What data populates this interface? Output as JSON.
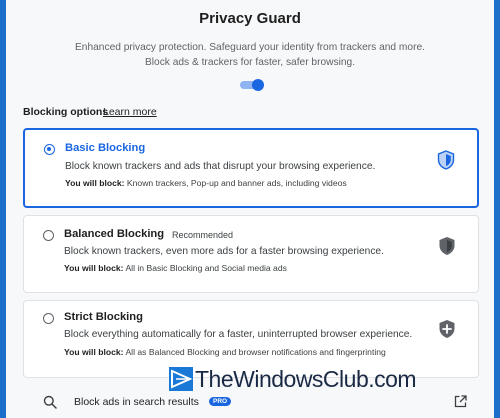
{
  "header": {
    "title": "Privacy Guard",
    "description": "Enhanced privacy protection. Safeguard your identity from trackers and more. Block ads & trackers for faster, safer browsing.",
    "toggle_on": true
  },
  "blocking": {
    "heading": "Blocking options",
    "learn_more": "Learn more",
    "block_prefix": "You will block:",
    "options": [
      {
        "title": "Basic Blocking",
        "tag": "",
        "selected": true,
        "description": "Block known trackers and ads that disrupt your browsing experience.",
        "blocks": "Known trackers, Pop-up and banner ads, including videos",
        "icon": "shield-icon"
      },
      {
        "title": "Balanced Blocking",
        "tag": "Recommended",
        "selected": false,
        "description": "Block known trackers, even more ads for a faster browsing experience.",
        "blocks": "All in Basic Blocking and Social media ads",
        "icon": "shield-icon"
      },
      {
        "title": "Strict Blocking",
        "tag": "",
        "selected": false,
        "description": "Block everything automatically for a faster, uninterrupted browser experience.",
        "blocks": "All as Balanced Blocking and browser notifications and fingerprinting",
        "icon": "shield-plus-icon"
      }
    ]
  },
  "search_ads": {
    "label": "Block ads in search results",
    "badge": "PRO",
    "icon": "search-icon",
    "action_icon": "external-link-icon"
  },
  "watermark": {
    "text": "TheWindowsClub.com"
  },
  "colors": {
    "accent": "#1a66e0",
    "background": "#f7f8fa",
    "frame": "#1b6fc8"
  }
}
